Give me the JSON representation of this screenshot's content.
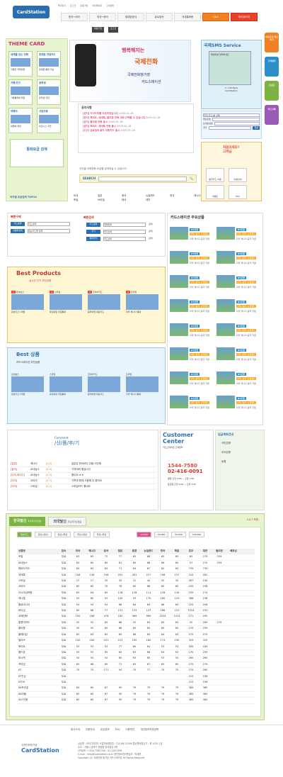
{
  "header": {
    "logo": "CardStation",
    "logo_sub": "카드스테이션",
    "top_links": [
      "즐겨찾기",
      "로그인",
      "회원가입",
      "마이페이지",
      "고객센터"
    ],
    "nav": [
      "한국→외국",
      "외국→한국",
      "휴대폰방식",
      "유로접속",
      "국내통화용",
      "Q&A",
      "마이페이지"
    ],
    "sub": [
      "회원가입",
      "로그인",
      "로그아웃"
    ]
  },
  "left_theme": {
    "title": "THEME CARD",
    "cards": [
      {
        "h": "세계를 잇는 전화",
        "d": "저렴한 국제전화"
      },
      {
        "h": "휴대폰 전용카드",
        "d": "휴대폰 통화 가능"
      },
      {
        "h": "가족/친구",
        "d": "가족통화에 적합"
      },
      {
        "h": "유학생",
        "d": "유학생 추천"
      },
      {
        "h": "여행자",
        "d": "여행에 적합"
      },
      {
        "h": "사업자용",
        "d": "비즈니스 추천"
      }
    ],
    "calc": "통화요금 검색"
  },
  "banner": {
    "l1": "행복해지는",
    "l2": "국제전화",
    "l3": "국제전화정거장",
    "l4": "카드스테이션"
  },
  "notice": {
    "title": "공지사항",
    "items": [
      {
        "t": "[공지] 가이드투를 오픈하였습니다",
        "d": "2005-01-18"
      },
      {
        "t": "[공지] 해외도, 세계톡, 졸라팝 전화 새로 선택할 수 있습니다",
        "d": "2005-01-18"
      },
      {
        "t": "[공지] 졸라팝 전화 출시",
        "d": "2005-01-18"
      },
      {
        "t": "[공지] 해외도, 세계톡 전화 출시",
        "d": "2005-01-18"
      },
      {
        "t": "[신규] 유로접속 회차 지원카드 출시",
        "d": "2005-01-18"
      }
    ]
  },
  "sms": {
    "title": "국제SMS Service",
    "screen_hint": "메세지를 입력하세요",
    "counter": "0 / 150 Byte",
    "brand": "CardStation",
    "labels": [
      "받는번호",
      "보내는번호",
      "국가"
    ],
    "send": "전송",
    "country_ph": "국가(코드)를 선택"
  },
  "right_box": {
    "title": "처음이세요? 고객님",
    "items": [
      "충전카드 이용",
      "이용안내",
      "이벤트",
      "FAQ"
    ]
  },
  "rail": [
    "이용요금 계산하기",
    "고객센터",
    "요금표",
    "카드구매"
  ],
  "search": {
    "label": "SEARCH",
    "note": "국가별 국제전화 요금을 검색하실 수 있습니다.",
    "placeholder": ""
  },
  "top10": {
    "label": "국가별 요금검색 TOP10",
    "countries": [
      "미국",
      "일본",
      "중국",
      "뉴질랜드",
      "영국",
      "캐나다",
      "독일",
      "브라질",
      "태국",
      "대만"
    ]
  },
  "quick": {
    "title": "빠른구매",
    "sub": "카드종류별 빠른 검색",
    "rows": [
      {
        "lb": "카드분류",
        "v": "카드선택"
      },
      {
        "lb": "상품명검색",
        "v": "찾는카드명 입력"
      }
    ],
    "title2": "빠른검색",
    "rows2": [
      {
        "lb": "카드종류",
        "v": "국제전화"
      },
      {
        "lb": "국가",
        "v": "국가선택"
      },
      {
        "lb": "통화방식",
        "v": "카드선택"
      }
    ],
    "go": "검색"
  },
  "hit": {
    "title": "카드스테이션 주요상품",
    "sub": "Cardstation Hit Item",
    "items": [
      {
        "n": "KT포켓",
        "t": "미국, 중국, 뉴질랜드",
        "d": "미국 캐나다 중국 저렴"
      }
    ]
  },
  "best": {
    "title": "Best Products",
    "sub": "실시간 인기 추천상품",
    "cards": [
      {
        "rk": "1",
        "n": "르네상스",
        "d": "유효기간 1개월"
      },
      {
        "rk": "2",
        "n": "스마일",
        "d": "유로화된 무료통화"
      },
      {
        "rk": "3",
        "n": "코리아카드",
        "d": "중국여행 대표카드"
      },
      {
        "rk": "4",
        "n": "프라임",
        "d": "미국 캐나다 통화"
      }
    ]
  },
  "best2": {
    "title": "Best 상품",
    "sub": "카드스테이션 추천상품",
    "cards": [
      {
        "n": "르네상스",
        "d": "유효기간 1개월"
      },
      {
        "n": "스마일",
        "d": "유로화된 무료통화"
      },
      {
        "n": "코리아카드",
        "d": "중국여행 대표카드"
      },
      {
        "n": "프라임",
        "d": "미국 캐나다 통화"
      }
    ]
  },
  "comment": {
    "title": "/상/품/후/기",
    "title_en": "Comment",
    "rows": [
      {
        "c": "[일본]",
        "n": "캐나다",
        "r": "[4.2]",
        "t": "일본은 한국보다 다음 이전에"
      },
      {
        "c": "[중국]",
        "n": "르네상스",
        "r": "[4.9]",
        "t": "가격대비 좋습니다"
      },
      {
        "c": "[미국,캐나다]",
        "n": "르네상스",
        "r": "[4.5]",
        "t": "좋아요 ㅎㅎ"
      },
      {
        "c": "[미국]",
        "n": "코리아",
        "r": "[4.7]",
        "t": "가족과 함께 사용해 더 좋아요"
      },
      {
        "c": "[미국]",
        "n": "스마일",
        "r": "[4.2]",
        "t": "스마일카드 좋네요"
      }
    ]
  },
  "cs": {
    "title": "Customer Center",
    "sub": "카드스테이션 고객센터",
    "phone": "1544-7580",
    "fax": "02-416-0091",
    "hours": "평일 오전 9:00 ~ 오후 7:00",
    "sat": "토요일 오전 9:00 ~ 오후 1:00"
  },
  "bank": {
    "title": "입금계좌안내",
    "banks": [
      "국민은행",
      "우리은행",
      "농협"
    ]
  },
  "rates": {
    "tab1": "한국발신",
    "tab1s": "주요국가요금표",
    "tab2": "외국발신",
    "tab2s": "주요국가요금표",
    "note": "V.A.T 포함",
    "filters": [
      "일반카드",
      "유선→유선",
      "유선→무선",
      "무선→유선",
      "무선→무선"
    ],
    "amounts": [
      "10,000",
      "30,000",
      "50,000",
      "100,000"
    ],
    "headers": [
      "상품명",
      "접속",
      "미국",
      "캐나다",
      "중국",
      "일본",
      "홍콩",
      "뉴질랜드",
      "영국",
      "독일",
      "호주",
      "대만",
      "필리핀",
      "베트남"
    ],
    "rows": [
      [
        "포알",
        "무료",
        "63",
        "65",
        "72",
        "77",
        "65",
        "68",
        "65",
        "65",
        "65",
        "270",
        "259"
      ],
      [
        "르네상스",
        "무료",
        "63",
        "65",
        "65",
        "81",
        "65",
        "68",
        "66",
        "65",
        "57",
        "270",
        "259"
      ],
      [
        "해외도카드",
        "무료",
        "63",
        "63",
        "63",
        "71",
        "64",
        "67",
        "62",
        "63",
        "739",
        "739"
      ],
      [
        "세계톡",
        "무료",
        "108",
        "108",
        "106",
        "202",
        "261",
        "227",
        "198",
        "157",
        "210",
        "282"
      ],
      [
        "스마일",
        "무료",
        "27",
        "27",
        "33",
        "33",
        "31",
        "44",
        "32",
        "35",
        "267",
        "190"
      ],
      [
        "코리아",
        "무료",
        "63",
        "65",
        "70",
        "78",
        "65",
        "68",
        "65",
        "65",
        "255",
        "238"
      ],
      [
        "아시아넘버원",
        "무료",
        "63",
        "64",
        "65",
        "118",
        "118",
        "111",
        "118",
        "149",
        "259",
        "274"
      ],
      [
        "캐나텔",
        "무료",
        "53",
        "60",
        "53",
        "100",
        "93",
        "170",
        "180",
        "125",
        "386",
        "238"
      ],
      [
        "할로아시아",
        "무료",
        "54",
        "54",
        "54",
        "66",
        "64",
        "64",
        "66",
        "64",
        "220",
        "208"
      ],
      [
        "바다섬",
        "무료",
        "85",
        "68",
        "77",
        "151",
        "133",
        "147",
        "168",
        "122",
        "1224",
        "233"
      ],
      [
        "국제전화",
        "무료",
        "100",
        "168",
        "476",
        "182",
        "969",
        "969",
        "1034",
        "1224",
        "271",
        "290"
      ],
      [
        "홍콩이카드",
        "무료",
        "52",
        "52",
        "63",
        "68",
        "52",
        "63",
        "63",
        "63",
        "52",
        "269",
        "270"
      ],
      [
        "졸라팝",
        "무료",
        "55",
        "55",
        "65",
        "68",
        "65",
        "65",
        "65",
        "65",
        "270",
        "259"
      ],
      [
        "플래티넘",
        "무료",
        "63",
        "63",
        "65",
        "65",
        "66",
        "65",
        "64",
        "63",
        "270",
        "270"
      ],
      [
        "빌리브",
        "무료",
        "140",
        "160",
        "201",
        "213",
        "190",
        "180",
        "174",
        "190",
        "329",
        "329"
      ],
      [
        "화이트",
        "무료",
        "53",
        "53",
        "53",
        "77",
        "60",
        "64",
        "53",
        "53",
        "185",
        "185"
      ],
      [
        "월드폰",
        "무료",
        "53",
        "53",
        "65",
        "65",
        "63",
        "68",
        "63",
        "63",
        "270",
        "259"
      ],
      [
        "퍼시픽",
        "무료",
        "54",
        "54",
        "54",
        "65",
        "63",
        "65",
        "53",
        "54",
        "260",
        "260"
      ],
      [
        "프라임",
        "무료",
        "65",
        "68",
        "65",
        "71",
        "65",
        "67",
        "65",
        "65",
        "270",
        "270"
      ],
      [
        "KT",
        "무료",
        "70",
        "75",
        "171",
        "94",
        "70",
        "77",
        "70",
        "75",
        "270",
        "280"
      ],
      [
        "KT안심",
        "무료",
        "",
        "",
        "",
        "",
        "",
        "",
        "",
        "",
        "210",
        "198"
      ],
      [
        "KTOS",
        "무료",
        "",
        "",
        "",
        "",
        "",
        "",
        "",
        "",
        "210",
        "196"
      ],
      [
        "SK프리폰",
        "무료",
        "63",
        "65",
        "67",
        "95",
        "79",
        "79",
        "79",
        "79",
        "385",
        "385"
      ],
      [
        "SK리필",
        "무료",
        "63",
        "65",
        "67",
        "95",
        "79",
        "79",
        "79",
        "79",
        "385",
        "385"
      ],
      [
        "SK7인용",
        "무료",
        "63",
        "65",
        "67",
        "95",
        "79",
        "79",
        "79",
        "79",
        "385",
        "385"
      ]
    ]
  },
  "footer": {
    "links": [
      "회사소개",
      "이용안내",
      "요금정보",
      "FAQ",
      "이용약관",
      "개인정보보호정책"
    ],
    "logo": "CardStation",
    "logo_sub": "국제전화정거장",
    "info": [
      "상호명 : 아이디미디어 사업자등록번호 : 215-86-11099 통신판매업신고 : 제 1032-1호",
      "주소 : 서울시 송파구 문정동 방이빌딩 3층",
      "고객센터 : 1544-7580 FAX : 02-416-0091",
      "E-mail : help@cardstation.co.kr 개인정보관리책임자 : 박재운",
      "Copyright (C) 국제전화 정거장 카드스테이션 All Rights Reserved"
    ]
  }
}
